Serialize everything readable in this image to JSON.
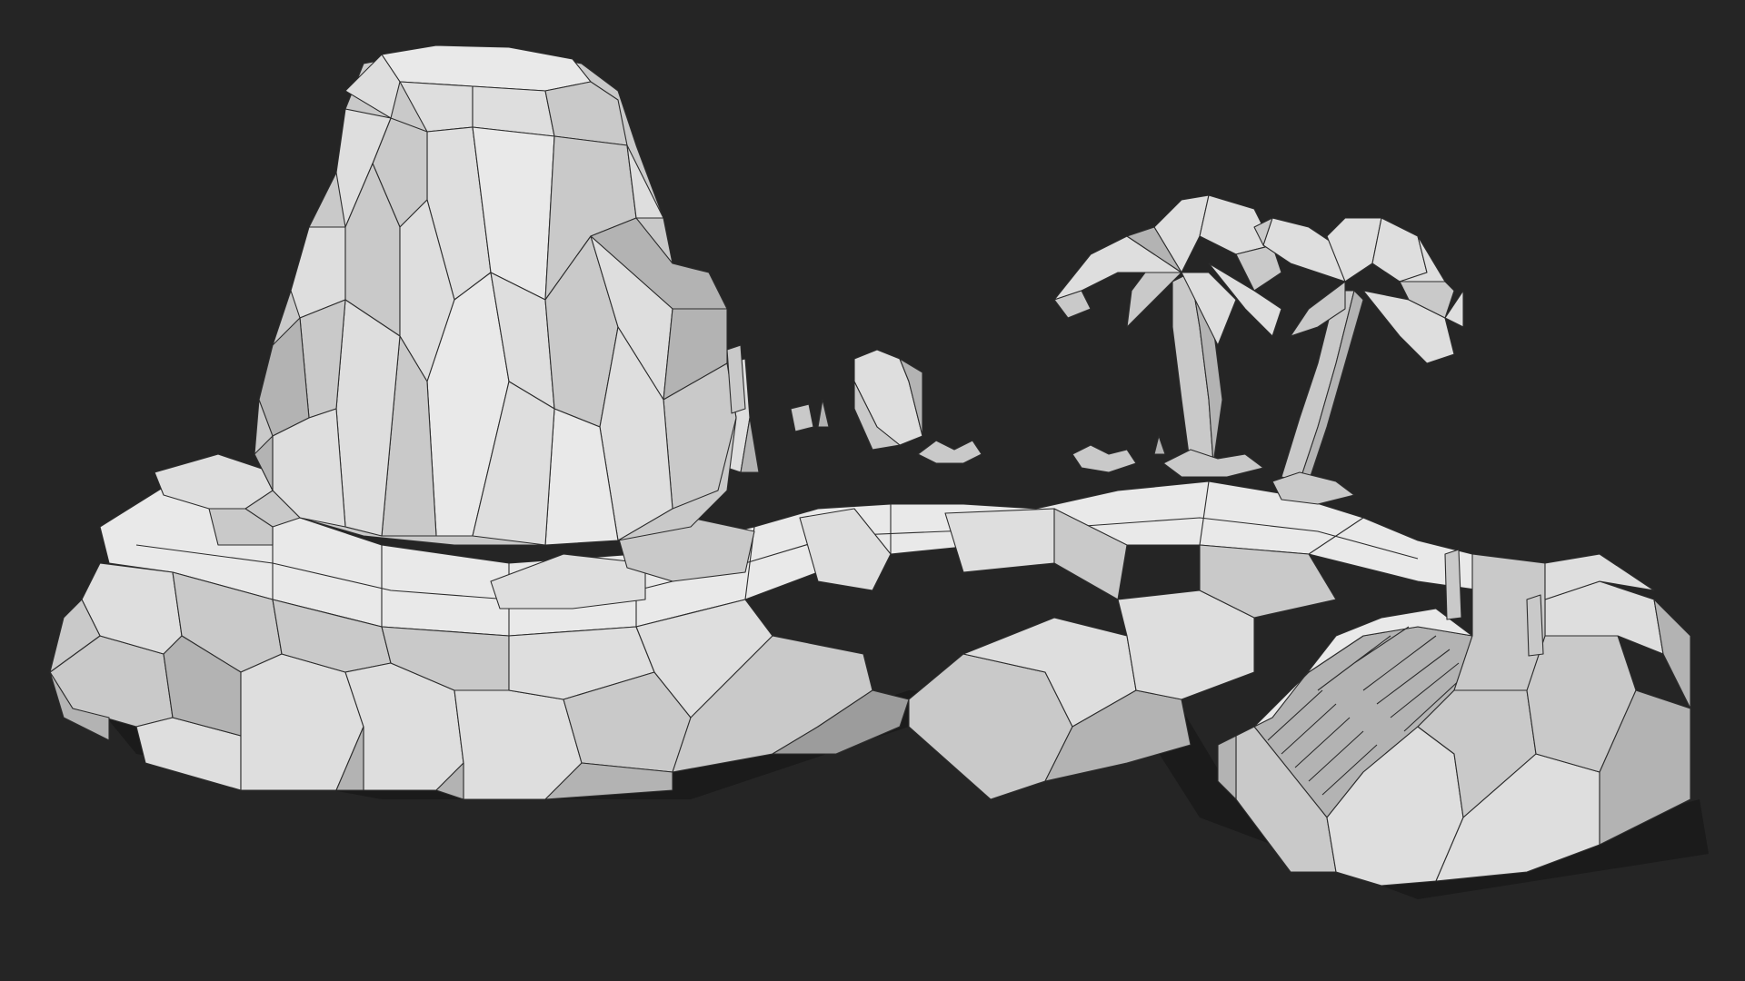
{
  "scene": {
    "description_visible_text": "",
    "background_color": "#252525",
    "model_color": "#d4d4d4",
    "wire_color": "#2c2c2c",
    "objects": [
      "volcano-rock",
      "island-base",
      "palm-tree-left",
      "palm-tree-right",
      "stone-pillar",
      "stairs",
      "small-plants"
    ]
  }
}
